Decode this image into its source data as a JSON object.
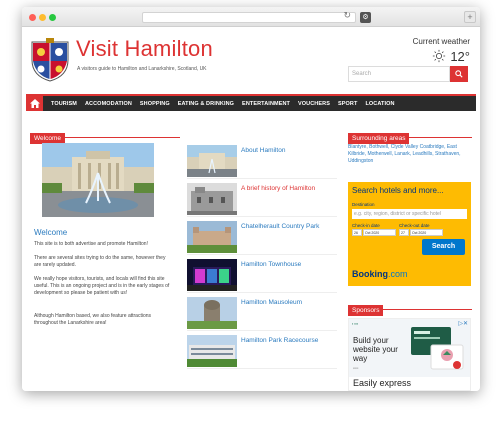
{
  "site": {
    "title": "Visit Hamilton",
    "tagline": "A visitors guide to Hamilton and Lanarkshire, Scotland, UK"
  },
  "weather": {
    "label": "Current weather",
    "temp": "12°",
    "icon": "sun-icon"
  },
  "search": {
    "placeholder": "Search"
  },
  "nav": {
    "items": [
      "TOURISM",
      "ACCOMODATION",
      "SHOPPING",
      "EATING & DRINKING",
      "ENTERTAINMENT",
      "VOUCHERS",
      "SPORT",
      "LOCATION"
    ]
  },
  "welcome": {
    "section_label": "Welcome",
    "title": "Welcome",
    "paragraphs": [
      "This site is to both advertise and promote Hamilton!",
      "There are several sites trying to do the same, however they are rarely updated.",
      "We really hope visitors, tourists, and locals will find this site useful. This is an ongoing project and is in the early stages of development so please be patient with us!",
      "Although Hamilton based, we also feature attractions throughout the Lanarkshire area!"
    ]
  },
  "attractions": [
    {
      "name": "About Hamilton"
    },
    {
      "name": "A brief history of Hamilton"
    },
    {
      "name": "Chatelherault Country Park"
    },
    {
      "name": "Hamilton Townhouse"
    },
    {
      "name": "Hamilton Mausoleum"
    },
    {
      "name": "Hamilton Park Racecourse"
    }
  ],
  "sidebar": {
    "surrounding": {
      "label": "Surrounding areas",
      "text": "Blantyre, Bothwell, Clyde Valley Coatbridge, East Kilbride, Motherwell, Lanark, Leadhills, Strathaven, Uddingston"
    },
    "booking": {
      "title": "Search hotels and more...",
      "destination_label": "Destination",
      "destination_placeholder": "e.g. city, region, district or specific hotel",
      "checkin_label": "Check-in date",
      "checkout_label": "Check-out date",
      "checkin_day": "26",
      "checkin_month": "Oct 2020",
      "checkout_day": "27",
      "checkout_month": "Oct 2020",
      "button": "Search",
      "logo_main": "Booking",
      "logo_suffix": ".com"
    },
    "sponsors": {
      "label": "Sponsors",
      "ad_headline": "Build your website your way",
      "ad_bottom": "Easily express"
    }
  },
  "colors": {
    "accent": "#dd3333",
    "nav_bg": "#2b2b2b",
    "link": "#2b7bbf",
    "booking_yellow": "#febb02",
    "booking_blue": "#003580"
  }
}
